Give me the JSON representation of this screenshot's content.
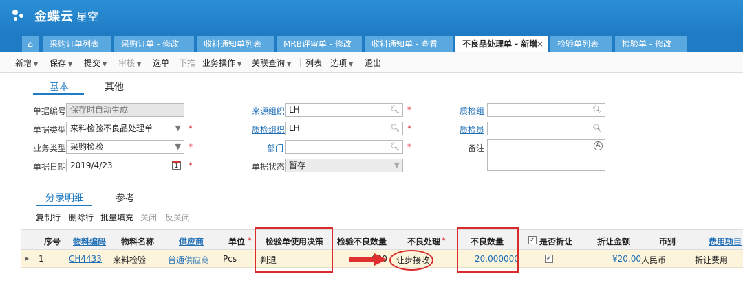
{
  "app": {
    "brand": "金蝶云",
    "product": "星空"
  },
  "tabs": [
    {
      "label": "采购订单列表"
    },
    {
      "label": "采购订单 - 修改"
    },
    {
      "label": "收料通知单列表"
    },
    {
      "label": "MRB评审单 - 修改"
    },
    {
      "label": "收料通知单 - 查看"
    },
    {
      "label": "不良品处理单 - 新增",
      "active": true
    },
    {
      "label": "检验单列表"
    },
    {
      "label": "检验单 - 修改"
    }
  ],
  "toolbar": {
    "new": "新增",
    "save": "保存",
    "submit": "提交",
    "audit": "审核",
    "select": "选单",
    "push": "下推",
    "business": "业务操作",
    "query": "关联查询",
    "list": "列表",
    "options": "选项",
    "exit": "退出"
  },
  "subtabs": {
    "basic": "基本",
    "other": "其他"
  },
  "form": {
    "bill_no_label": "单据编号",
    "bill_no_placeholder": "保存时自动生成",
    "bill_type_label": "单据类型",
    "bill_type_value": "来料检验不良品处理单",
    "biz_type_label": "业务类型",
    "biz_type_value": "采购检验",
    "date_label": "单据日期",
    "date_value": "2019/4/23",
    "source_org_label": "来源组织",
    "source_org_value": "LH",
    "qc_org_label": "质检组织",
    "qc_org_value": "LH",
    "dept_label": "部门",
    "dept_value": "",
    "status_label": "单据状态",
    "status_value": "暂存",
    "qc_group_label": "质检组",
    "qc_group_value": "",
    "inspector_label": "质检员",
    "inspector_value": "",
    "remark_label": "备注"
  },
  "entry_tabs": {
    "detail": "分录明细",
    "ref": "参考"
  },
  "grid_toolbar": {
    "copy": "复制行",
    "delete": "删除行",
    "batch": "批量填充",
    "close": "关闭",
    "reopen": "反关闭"
  },
  "grid": {
    "columns": {
      "seq": "序号",
      "material_code": "物料编码",
      "material_name": "物料名称",
      "supplier": "供应商",
      "unit": "单位",
      "decision": "检验单使用决策",
      "insp_bad_qty": "检验不良数量",
      "handling": "不良处理",
      "bad_qty": "不良数量",
      "discount": "是否折让",
      "discount_amount": "折让金额",
      "currency": "币别",
      "fee_item": "费用项目"
    },
    "rows": [
      {
        "seq": "1",
        "material_code": "CH4433",
        "material_name": "来料检验",
        "supplier": "普通供应商",
        "unit": "Pcs",
        "decision": "判退",
        "insp_bad_qty_partial": "000",
        "handling": "让步接收",
        "bad_qty": "20.000000",
        "discount": "✓",
        "discount_amount": "¥20.00",
        "currency": "人民币",
        "fee_item": "折让费用"
      }
    ]
  },
  "colors": {
    "brand_blue": "#1f7cc4",
    "highlight_red": "#d92b2b"
  }
}
